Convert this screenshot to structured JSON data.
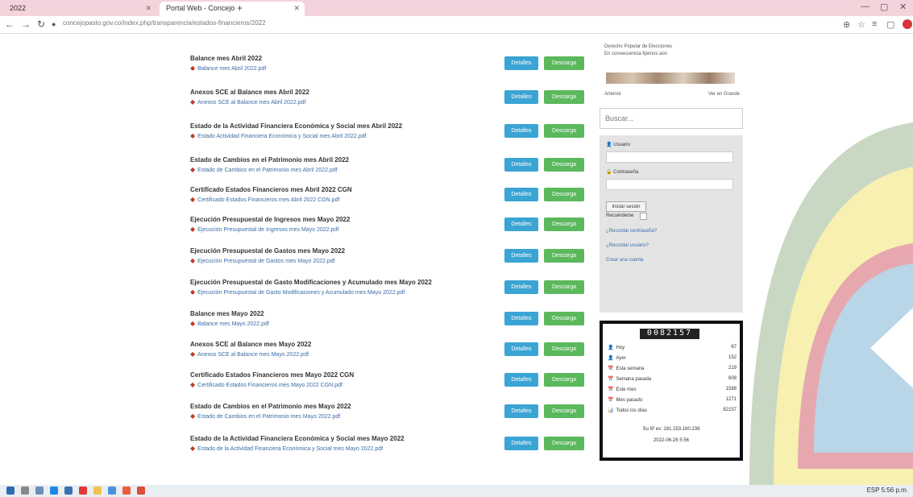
{
  "browser": {
    "tab1_title": "2022",
    "tab2_title": "Portal Web - Concejo",
    "url": "concejopasto.gov.co/index.php/transparencia/estados-financieros/2022"
  },
  "documents": [
    {
      "title": "Balance mes Abril 2022",
      "file": "Balance mes Abril 2022.pdf"
    },
    {
      "title": "Anexos SCE al Balance mes Abril 2022",
      "file": "Anexos SCE al Balance mes Abril 2022.pdf"
    },
    {
      "title": "Estado de la Actividad Financiera Económica y Social mes Abril 2022",
      "file": "Estado Actividad Financiera Económica y Social mes Abril 2022.pdf"
    },
    {
      "title": "Estado de Cambios en el Patrimonio mes Abril 2022",
      "file": "Estado de Cambios en el Patrimonio mes Abril 2022.pdf"
    },
    {
      "title": "Certificado Estados Financieros mes Abril 2022 CGN",
      "file": "Certificado Estados Financieros mes Abril 2022 CGN.pdf"
    },
    {
      "title": "Ejecución Presupuestal de Ingresos mes Mayo 2022",
      "file": "Ejecución Presupuestal de Ingresos mes Mayo 2022.pdf"
    },
    {
      "title": "Ejecución Presupuestal de Gastos mes Mayo 2022",
      "file": "Ejecución Presupuestal de Gastos mes Mayo 2022.pdf"
    },
    {
      "title": "Ejecución Presupuestal de Gasto Modificaciones y Acumulado mes Mayo 2022",
      "file": "Ejecución Presupuestal de Gasto Modificaciones y Acumulado mes Mayo 2022.pdf"
    },
    {
      "title": "Balance mes Mayo 2022",
      "file": "Balance mes Mayo 2022.pdf"
    },
    {
      "title": "Anexos SCE al Balance mes Mayo 2022",
      "file": "Anexos SCE al Balance mes Mayo 2022.pdf"
    },
    {
      "title": "Certificado Estados Financieros mes Mayo 2022 CGN",
      "file": "Certificado Estados Financieros mes Mayo 2022 CGN.pdf"
    },
    {
      "title": "Estado de Cambios en el Patrimonio mes Mayo 2022",
      "file": "Estado de Cambios en el Patrimonio mes Mayo 2022.pdf"
    },
    {
      "title": "Estado de la Actividad Financiera Económica y Social mes Mayo 2022",
      "file": "Estado de la Actividad Financiera Económica y Social mes Mayo 2022.pdf"
    }
  ],
  "buttons": {
    "details": "Detalles",
    "download": "Descarga"
  },
  "sidebar": {
    "news_line1": "Derecho Popular de Elecciones",
    "news_line2": "En consecuencia fijemos aún",
    "news_left": "Anterior",
    "news_right": "Ver en Grande",
    "search_placeholder": "Buscar...",
    "user_label": "Usuario",
    "password_label": "Contraseña",
    "login_button": "Iniciar sesión",
    "remember_label": "Recuérdeme",
    "forgot_password": "¿Recordar contraseña?",
    "forgot_user": "¿Recordar usuario?",
    "create_account": "Crear una cuenta"
  },
  "counter": {
    "digits": "0082157",
    "stats": [
      {
        "label": "Hoy",
        "value": "67"
      },
      {
        "label": "Ayer",
        "value": "152"
      },
      {
        "label": "Esta semana",
        "value": "219"
      },
      {
        "label": "Semana pasada",
        "value": "608"
      },
      {
        "label": "Este mes",
        "value": "1588"
      },
      {
        "label": "Mes pasado",
        "value": "1271"
      },
      {
        "label": "Todos los días",
        "value": "82157"
      }
    ],
    "ip_line": "Su IP es: 181.153.160.238",
    "date_line": "2022-06-26 5:56"
  },
  "taskbar": {
    "tray_text": "ESP 5:56 p.m."
  }
}
